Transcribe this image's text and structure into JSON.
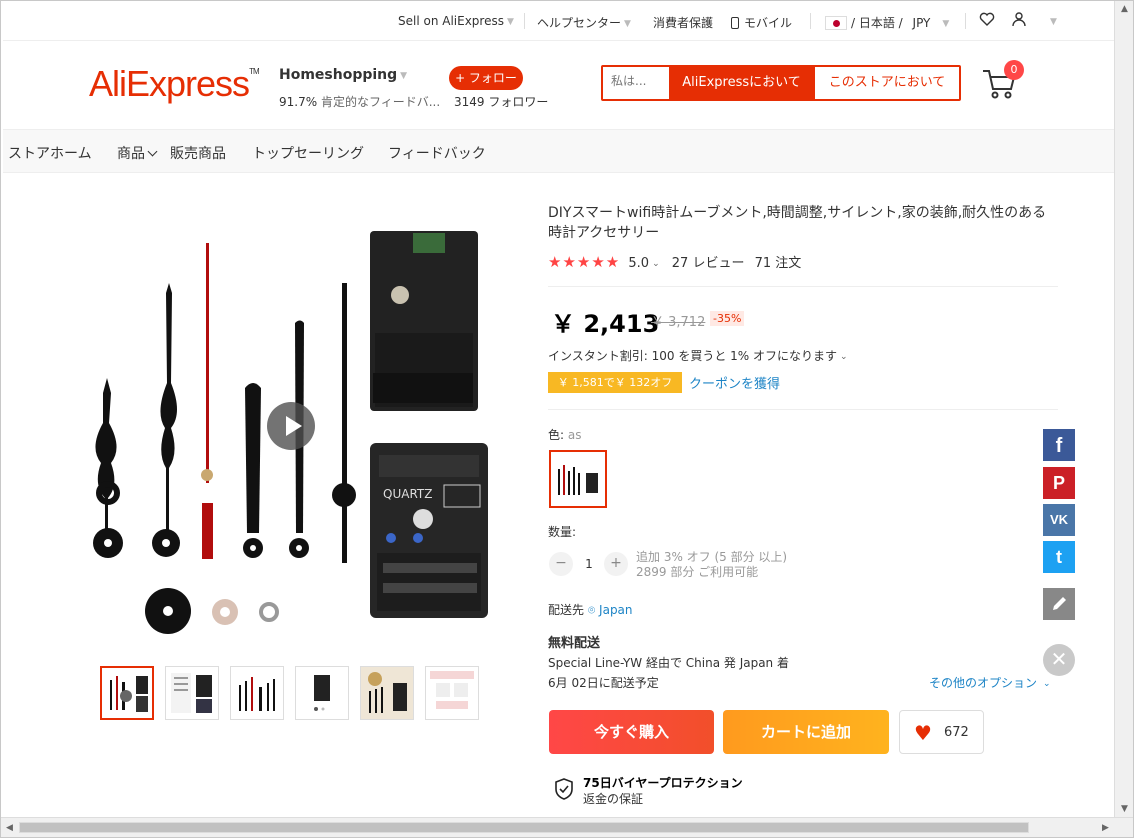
{
  "topbar": {
    "sell": "Sell on AliExpress",
    "help": "ヘルプセンター",
    "buyer": "消費者保護",
    "mobile": "モバイル",
    "lang": "/ 日本語 /",
    "currency": "JPY"
  },
  "header": {
    "logo": "AliExpress",
    "store_name": "Homeshopping",
    "feedback_pct": "91.7%",
    "feedback_text": "肯定的なフィードバ...",
    "follow_label": "+ フォロー",
    "followers_count": "3149",
    "followers_label": "フォロワー",
    "search_placeholder": "私は...",
    "search_all": "AliExpressにおいて",
    "search_store": "このストアにおいて",
    "cart_count": "0"
  },
  "nav": {
    "items": [
      "ストアホーム",
      "商品",
      "販売商品",
      "トップセーリング",
      "フィードバック"
    ]
  },
  "product": {
    "title": "DIYスマートwifi時計ムーブメント,時間調整,サイレント,家の装飾,耐久性のある時計アクセサリー",
    "stars": "★★★★★",
    "rating": "5.0",
    "reviews": "27 レビュー",
    "orders": "71 注文",
    "price": "￥ 2,413",
    "old_price": "￥ 3,712",
    "discount": "-35%",
    "instant": "インスタント割引: 100 を買うと 1% オフになります",
    "coupon_tag": "￥ 1,581で￥ 132オフ",
    "coupon_link": "クーポンを獲得",
    "color_label": "色:",
    "color_value": "as",
    "qty_label": "数量:",
    "qty_value": "1",
    "qty_info1": "追加 3% オフ (5 部分 以上)",
    "qty_info2": "2899 部分 ご利用可能",
    "ship_to_label": "配送先",
    "ship_to": "Japan",
    "free_shipping": "無料配送",
    "ship_via": "Special Line-YW 経由で China 発 Japan 着",
    "ship_date": "6月 02日に配送予定",
    "other_options": "その他のオプション",
    "buy_now": "今すぐ購入",
    "add_cart": "カートに追加",
    "wish_count": "672",
    "protect_title": "75日バイヤープロテクション",
    "protect_sub": "返金の保証"
  },
  "social": {
    "facebook": "f",
    "pinterest": "P",
    "vk": "VK",
    "twitter": "t"
  },
  "colors": {
    "brand": "#e62e04",
    "coupon": "#f8b823",
    "link": "#1d84c6"
  }
}
